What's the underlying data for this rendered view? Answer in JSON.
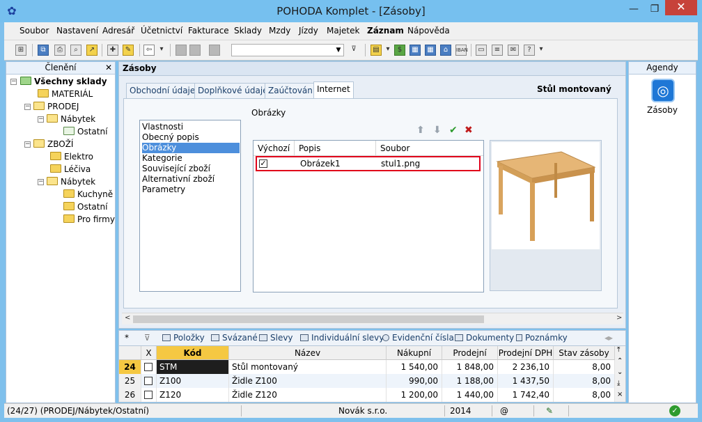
{
  "window": {
    "title": "POHODA Komplet - [Zásoby]"
  },
  "menu": [
    "Soubor",
    "Nastavení",
    "Adresář",
    "Účetnictví",
    "Fakturace",
    "Sklady",
    "Mzdy",
    "Jízdy",
    "Majetek",
    "Záznam",
    "Nápověda"
  ],
  "left_panel": {
    "title": "Členění",
    "tree": [
      {
        "label": "Všechny sklady",
        "level": 0,
        "bold": true
      },
      {
        "label": "MATERIÁL",
        "level": 1
      },
      {
        "label": "PRODEJ",
        "level": 1
      },
      {
        "label": "Nábytek",
        "level": 2
      },
      {
        "label": "Ostatní",
        "level": 3
      },
      {
        "label": "ZBOŽÍ",
        "level": 1
      },
      {
        "label": "Elektro",
        "level": 2
      },
      {
        "label": "Léčiva",
        "level": 2
      },
      {
        "label": "Nábytek",
        "level": 2
      },
      {
        "label": "Kuchyně",
        "level": 3
      },
      {
        "label": "Ostatní",
        "level": 3
      },
      {
        "label": "Pro firmy",
        "level": 3
      }
    ]
  },
  "center": {
    "title": "Zásoby",
    "tabs": [
      "Obchodní údaje",
      "Doplňkové údaje",
      "Zaúčtování",
      "Internet"
    ],
    "active_tab": "Internet",
    "product_name": "Stůl montovaný",
    "section_label": "Obrázky",
    "list_items": [
      "Vlastnosti",
      "Obecný popis",
      "Obrázky",
      "Kategorie",
      "Související zboží",
      "Alternativní zboží",
      "Parametry"
    ],
    "selected_item": "Obrázky",
    "images_grid": {
      "headers": [
        "Výchozí",
        "Popis",
        "Soubor"
      ],
      "rows": [
        {
          "default": true,
          "popis": "Obrázek1",
          "soubor": "stul1.png"
        }
      ]
    }
  },
  "right_panel": {
    "title": "Agendy",
    "item_label": "Zásoby"
  },
  "bottom": {
    "tabs": [
      "Položky",
      "Svázané",
      "Slevy",
      "Individuální slevy",
      "Evidenční čísla",
      "Dokumenty",
      "Poznámky"
    ],
    "headers": [
      "X",
      "Kód",
      "Název",
      "Nákupní",
      "Prodejní",
      "Prodejní DPH",
      "Stav zásoby"
    ],
    "rows": [
      {
        "n": "24",
        "kod": "STM",
        "nazev": "Stůl montovaný",
        "nakupni": "1 540,00",
        "prodejni": "1 848,00",
        "dph": "2 236,10",
        "stav": "8,00"
      },
      {
        "n": "25",
        "kod": "Z100",
        "nazev": "Židle Z100",
        "nakupni": "990,00",
        "prodejni": "1 188,00",
        "dph": "1 437,50",
        "stav": "8,00"
      },
      {
        "n": "26",
        "kod": "Z120",
        "nazev": "Židle Z120",
        "nakupni": "1 200,00",
        "prodejni": "1 440,00",
        "dph": "1 742,40",
        "stav": "8,00"
      }
    ]
  },
  "status": {
    "path": "(24/27) (PRODEJ/Nábytek/Ostatní)",
    "company": "Novák s.r.o.",
    "year": "2014",
    "at": "@"
  },
  "colors": {
    "selection": "#4d8fdc",
    "highlight_border": "#e0001a",
    "current_row_num": "#f5c842",
    "kod_header": "#f5c842"
  }
}
